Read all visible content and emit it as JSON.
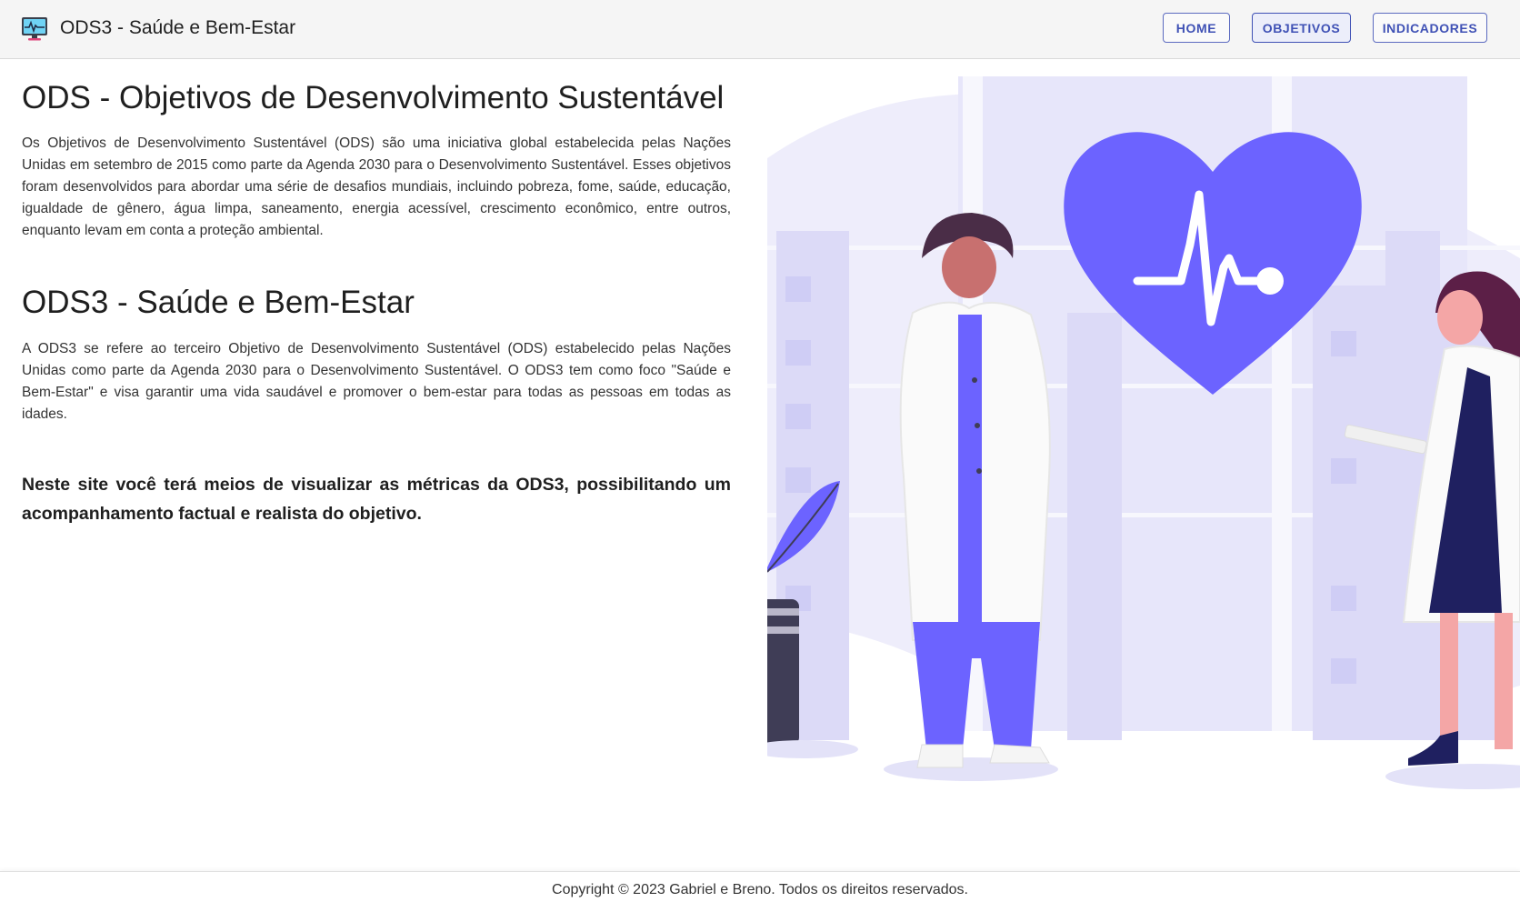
{
  "header": {
    "title": "ODS3 - Saúde e Bem-Estar",
    "nav": [
      {
        "label": "HOME"
      },
      {
        "label": "OBJETIVOS"
      },
      {
        "label": "INDICADORES"
      }
    ],
    "active_index": 1
  },
  "main": {
    "heading_1": "ODS - Objetivos de Desenvolvimento Sustentável",
    "paragraph_1": "Os Objetivos de Desenvolvimento Sustentável (ODS) são uma iniciativa global estabelecida pelas Nações Unidas em setembro de 2015 como parte da Agenda 2030 para o Desenvolvimento Sustentável. Esses objetivos foram desenvolvidos para abordar uma série de desafios mundiais, incluindo pobreza, fome, saúde, educação, igualdade de gênero, água limpa, saneamento, energia acessível, crescimento econômico, entre outros, enquanto levam em conta a proteção ambiental.",
    "heading_2": "ODS3 - Saúde e Bem-Estar",
    "paragraph_2": "A ODS3 se refere ao terceiro Objetivo de Desenvolvimento Sustentável (ODS) estabelecido pelas Nações Unidas como parte da Agenda 2030 para o Desenvolvimento Sustentável. O ODS3 tem como foco \"Saúde e Bem-Estar\" e visa garantir uma vida saudável e promover o bem-estar para todas as pessoas em todas as idades.",
    "lead": "Neste site você terá meios de visualizar as métricas da ODS3, possibilitando um acompanhamento factual e realista do objetivo."
  },
  "footer": {
    "copyright": "Copyright © 2023 Gabriel e Breno. Todos os direitos reservados."
  },
  "colors": {
    "accent": "#6c63ff",
    "nav_text": "#3f51b5",
    "topbar_bg": "#f5f5f5",
    "dark_navy": "#1f2060",
    "skin": "#c8706f"
  },
  "icons": {
    "brand": "monitor-heartbeat-icon"
  }
}
